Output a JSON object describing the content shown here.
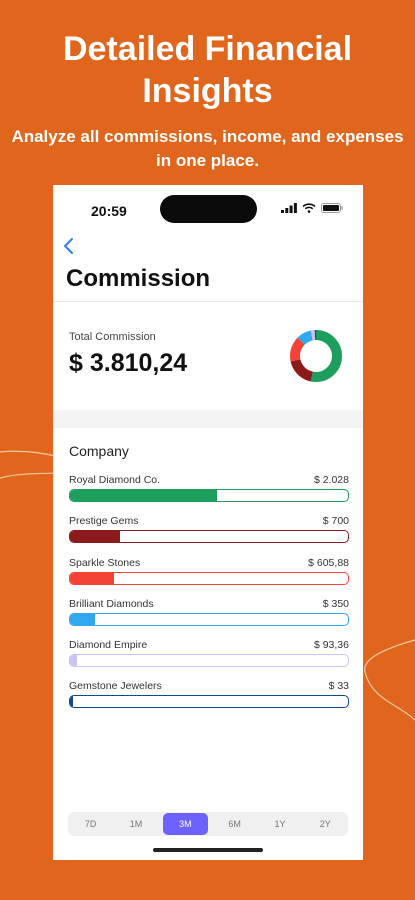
{
  "promo": {
    "headline": "Detailed Financial Insights",
    "subline": "Analyze all commissions, income, and expenses in one place."
  },
  "status_bar": {
    "time": "20:59",
    "icons": [
      "signal-icon",
      "wifi-icon",
      "battery-icon"
    ]
  },
  "header": {
    "back_icon": "chevron-left-icon",
    "title": "Commission"
  },
  "summary": {
    "label": "Total Commission",
    "value": "$ 3.810,24"
  },
  "donut_segments": [
    {
      "share": 0.532,
      "color": "#1E9E5C"
    },
    {
      "share": 0.184,
      "color": "#8B1A1A"
    },
    {
      "share": 0.159,
      "color": "#F44336"
    },
    {
      "share": 0.092,
      "color": "#2FA8F0"
    },
    {
      "share": 0.025,
      "color": "#C9C4F5"
    },
    {
      "share": 0.009,
      "color": "#0D4B8C"
    }
  ],
  "company": {
    "title": "Company",
    "items": [
      {
        "name": "Royal Diamond Co.",
        "amount": "$ 2.028",
        "fraction": 0.53,
        "color": "#1E9E5C"
      },
      {
        "name": "Prestige Gems",
        "amount": "$ 700",
        "fraction": 0.18,
        "color": "#8B1A1A"
      },
      {
        "name": "Sparkle Stones",
        "amount": "$ 605,88",
        "fraction": 0.16,
        "color": "#F44336"
      },
      {
        "name": "Brilliant Diamonds",
        "amount": "$ 350",
        "fraction": 0.09,
        "color": "#2FA8F0"
      },
      {
        "name": "Diamond Empire",
        "amount": "$ 93,36",
        "fraction": 0.025,
        "color": "#C9C4F5"
      },
      {
        "name": "Gemstone Jewelers",
        "amount": "$ 33",
        "fraction": 0.009,
        "color": "#0D4B8C"
      }
    ]
  },
  "period_tabs": {
    "items": [
      "7D",
      "1M",
      "3M",
      "6M",
      "1Y",
      "2Y"
    ],
    "selected": "3M",
    "accent": "#6C63FF"
  }
}
